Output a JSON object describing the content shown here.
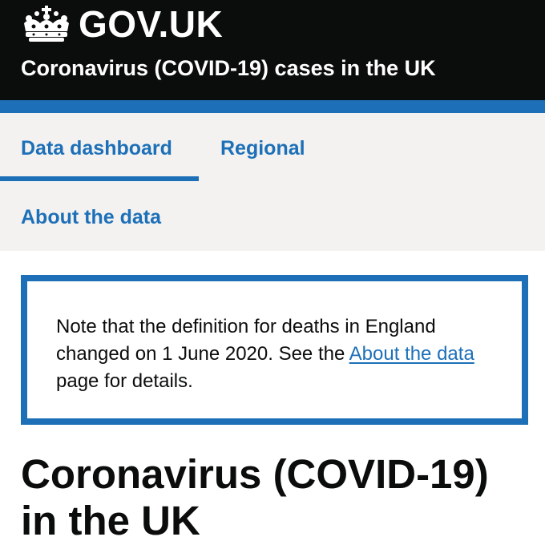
{
  "header": {
    "logo_text": "GOV.UK",
    "service_name": "Coronavirus (COVID-19) cases in the UK",
    "crown_icon": "crown-icon"
  },
  "nav": {
    "items": [
      {
        "label": "Data dashboard",
        "active": true
      },
      {
        "label": "Regional",
        "active": false
      },
      {
        "label": "About the data",
        "active": false
      }
    ]
  },
  "notice": {
    "text_before": "Note that the definition for deaths in England changed on 1 June 2020. See the ",
    "link_text": "About the data",
    "text_after": " page for details."
  },
  "page": {
    "title": "Coronavirus (COVID-19) in the UK"
  },
  "colors": {
    "header_bg": "#0b0c0c",
    "brand_blue": "#1d70b8",
    "nav_bg": "#f3f2f1",
    "text": "#0b0c0c"
  }
}
